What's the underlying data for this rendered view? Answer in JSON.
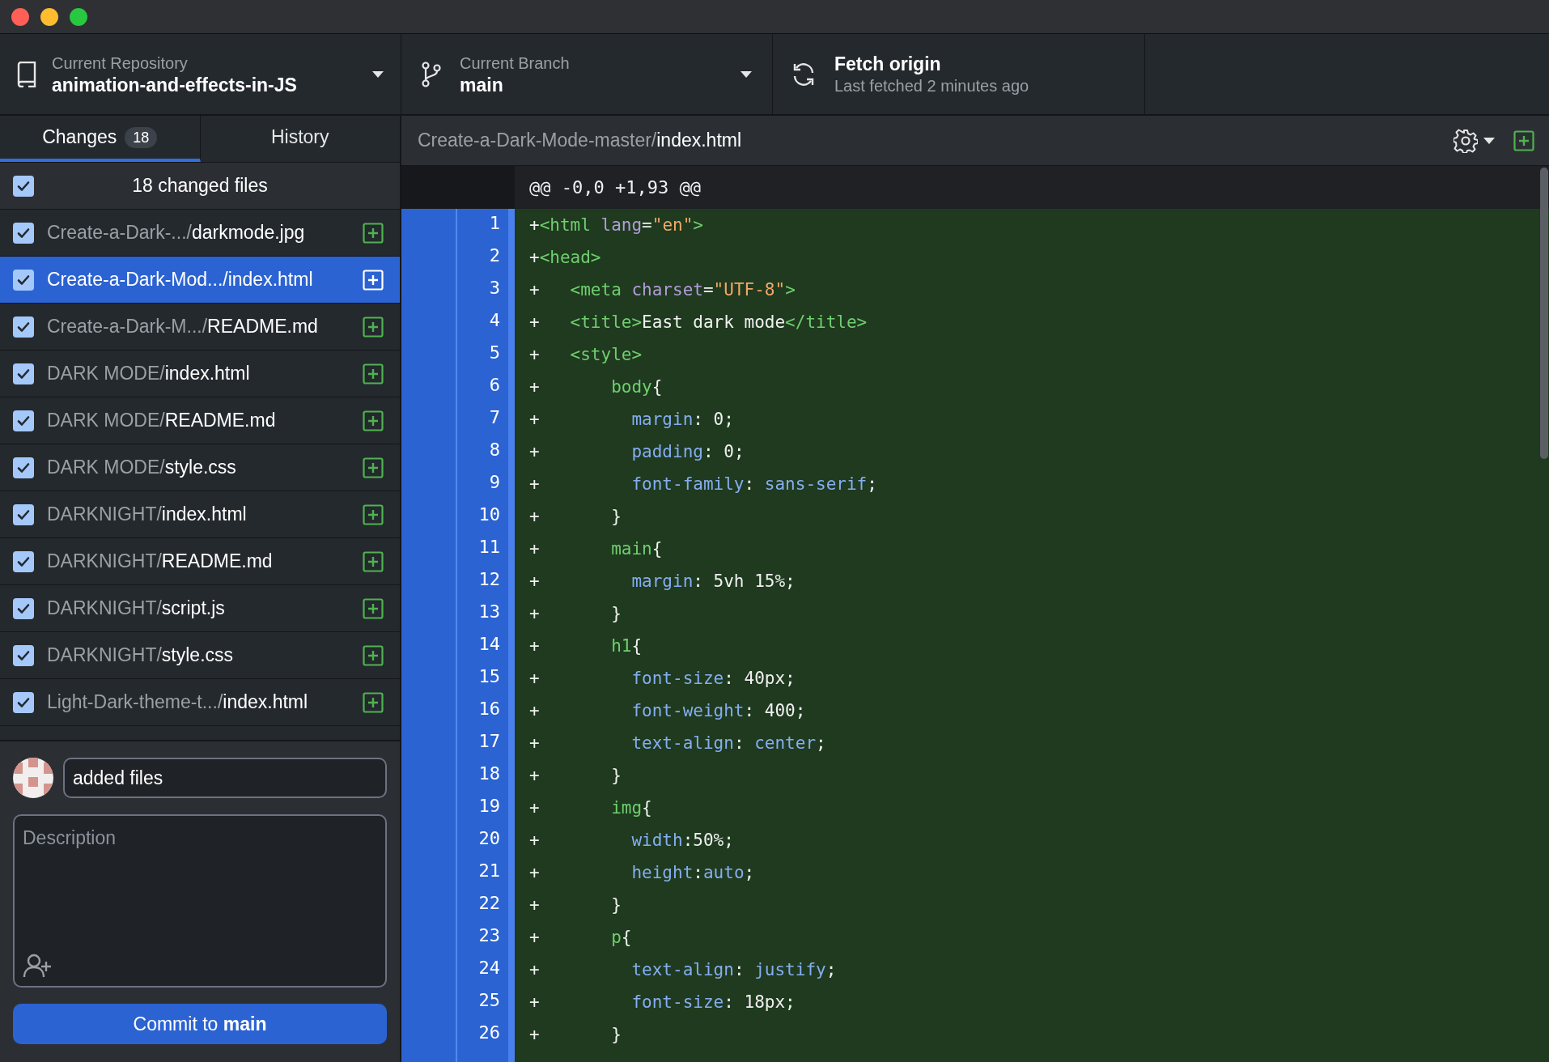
{
  "toolbar": {
    "repository": {
      "label": "Current Repository",
      "name": "animation-and-effects-in-JS"
    },
    "branch": {
      "label": "Current Branch",
      "name": "main"
    },
    "fetch": {
      "title": "Fetch origin",
      "subtitle": "Last fetched 2 minutes ago"
    }
  },
  "tabs": [
    {
      "label": "Changes",
      "count": "18",
      "selected": true
    },
    {
      "label": "History",
      "selected": false
    }
  ],
  "changes_header": {
    "label": "18 changed files",
    "checked": true
  },
  "files": [
    {
      "dir": "Create-a-Dark-.../",
      "file": "darkmode.jpg",
      "checked": true,
      "selected": false
    },
    {
      "dir": "Create-a-Dark-Mod.../",
      "file": "index.html",
      "checked": true,
      "selected": true
    },
    {
      "dir": "Create-a-Dark-M.../",
      "file": "README.md",
      "checked": true,
      "selected": false
    },
    {
      "dir": "DARK MODE/",
      "file": "index.html",
      "checked": true,
      "selected": false
    },
    {
      "dir": "DARK MODE/",
      "file": "README.md",
      "checked": true,
      "selected": false
    },
    {
      "dir": "DARK MODE/",
      "file": "style.css",
      "checked": true,
      "selected": false
    },
    {
      "dir": "DARKNIGHT/",
      "file": "index.html",
      "checked": true,
      "selected": false
    },
    {
      "dir": "DARKNIGHT/",
      "file": "README.md",
      "checked": true,
      "selected": false
    },
    {
      "dir": "DARKNIGHT/",
      "file": "script.js",
      "checked": true,
      "selected": false
    },
    {
      "dir": "DARKNIGHT/",
      "file": "style.css",
      "checked": true,
      "selected": false
    },
    {
      "dir": "Light-Dark-theme-t.../",
      "file": "index.html",
      "checked": true,
      "selected": false
    }
  ],
  "commit": {
    "summary": "added files",
    "description_placeholder": "Description",
    "button": "Commit to **main**"
  },
  "diff": {
    "path": {
      "dir": "Create-a-Dark-Mode-master/",
      "file": "index.html"
    },
    "hunk": "@@ -0,0 +1,93 @@",
    "lines": [
      {
        "number": "1",
        "tokens": [
          {
            "kind": "plain",
            "text": "+"
          },
          {
            "kind": "tag",
            "text": "<html "
          },
          {
            "kind": "attr",
            "text": "lang"
          },
          {
            "kind": "plain",
            "text": "="
          },
          {
            "kind": "string",
            "text": "\"en\""
          },
          {
            "kind": "tag",
            "text": ">"
          }
        ]
      },
      {
        "number": "2",
        "tokens": [
          {
            "kind": "plain",
            "text": "+"
          },
          {
            "kind": "tag",
            "text": "<head>"
          }
        ]
      },
      {
        "number": "3",
        "tokens": [
          {
            "kind": "plain",
            "text": "+   "
          },
          {
            "kind": "tag",
            "text": "<meta "
          },
          {
            "kind": "attr",
            "text": "charset"
          },
          {
            "kind": "plain",
            "text": "="
          },
          {
            "kind": "string",
            "text": "\"UTF-8\""
          },
          {
            "kind": "tag",
            "text": ">"
          }
        ]
      },
      {
        "number": "4",
        "tokens": [
          {
            "kind": "plain",
            "text": "+   "
          },
          {
            "kind": "tag",
            "text": "<title>"
          },
          {
            "kind": "plain",
            "text": "East dark mode"
          },
          {
            "kind": "tag",
            "text": "</title>"
          }
        ]
      },
      {
        "number": "5",
        "tokens": [
          {
            "kind": "plain",
            "text": "+   "
          },
          {
            "kind": "tag",
            "text": "<style>"
          }
        ]
      },
      {
        "number": "6",
        "tokens": [
          {
            "kind": "plain",
            "text": "+       "
          },
          {
            "kind": "selector",
            "text": "body"
          },
          {
            "kind": "plain",
            "text": "{"
          }
        ]
      },
      {
        "number": "7",
        "tokens": [
          {
            "kind": "plain",
            "text": "+         "
          },
          {
            "kind": "property",
            "text": "margin"
          },
          {
            "kind": "plain",
            "text": ": 0;"
          }
        ]
      },
      {
        "number": "8",
        "tokens": [
          {
            "kind": "plain",
            "text": "+         "
          },
          {
            "kind": "property",
            "text": "padding"
          },
          {
            "kind": "plain",
            "text": ": 0;"
          }
        ]
      },
      {
        "number": "9",
        "tokens": [
          {
            "kind": "plain",
            "text": "+         "
          },
          {
            "kind": "property",
            "text": "font-family"
          },
          {
            "kind": "plain",
            "text": ": "
          },
          {
            "kind": "value",
            "text": "sans-serif"
          },
          {
            "kind": "plain",
            "text": ";"
          }
        ]
      },
      {
        "number": "10",
        "tokens": [
          {
            "kind": "plain",
            "text": "+       }"
          }
        ]
      },
      {
        "number": "11",
        "tokens": [
          {
            "kind": "plain",
            "text": "+       "
          },
          {
            "kind": "selector",
            "text": "main"
          },
          {
            "kind": "plain",
            "text": "{"
          }
        ]
      },
      {
        "number": "12",
        "tokens": [
          {
            "kind": "plain",
            "text": "+         "
          },
          {
            "kind": "property",
            "text": "margin"
          },
          {
            "kind": "plain",
            "text": ": 5vh 15%;"
          }
        ]
      },
      {
        "number": "13",
        "tokens": [
          {
            "kind": "plain",
            "text": "+       }"
          }
        ]
      },
      {
        "number": "14",
        "tokens": [
          {
            "kind": "plain",
            "text": "+       "
          },
          {
            "kind": "selector",
            "text": "h1"
          },
          {
            "kind": "plain",
            "text": "{"
          }
        ]
      },
      {
        "number": "15",
        "tokens": [
          {
            "kind": "plain",
            "text": "+         "
          },
          {
            "kind": "property",
            "text": "font-size"
          },
          {
            "kind": "plain",
            "text": ": 40px;"
          }
        ]
      },
      {
        "number": "16",
        "tokens": [
          {
            "kind": "plain",
            "text": "+         "
          },
          {
            "kind": "property",
            "text": "font-weight"
          },
          {
            "kind": "plain",
            "text": ": 400;"
          }
        ]
      },
      {
        "number": "17",
        "tokens": [
          {
            "kind": "plain",
            "text": "+         "
          },
          {
            "kind": "property",
            "text": "text-align"
          },
          {
            "kind": "plain",
            "text": ": "
          },
          {
            "kind": "value",
            "text": "center"
          },
          {
            "kind": "plain",
            "text": ";"
          }
        ]
      },
      {
        "number": "18",
        "tokens": [
          {
            "kind": "plain",
            "text": "+       }"
          }
        ]
      },
      {
        "number": "19",
        "tokens": [
          {
            "kind": "plain",
            "text": "+       "
          },
          {
            "kind": "selector",
            "text": "img"
          },
          {
            "kind": "plain",
            "text": "{"
          }
        ]
      },
      {
        "number": "20",
        "tokens": [
          {
            "kind": "plain",
            "text": "+         "
          },
          {
            "kind": "property",
            "text": "width"
          },
          {
            "kind": "plain",
            "text": ":50%;"
          }
        ]
      },
      {
        "number": "21",
        "tokens": [
          {
            "kind": "plain",
            "text": "+         "
          },
          {
            "kind": "property",
            "text": "height"
          },
          {
            "kind": "plain",
            "text": ":"
          },
          {
            "kind": "value",
            "text": "auto"
          },
          {
            "kind": "plain",
            "text": ";"
          }
        ]
      },
      {
        "number": "22",
        "tokens": [
          {
            "kind": "plain",
            "text": "+       }"
          }
        ]
      },
      {
        "number": "23",
        "tokens": [
          {
            "kind": "plain",
            "text": "+       "
          },
          {
            "kind": "selector",
            "text": "p"
          },
          {
            "kind": "plain",
            "text": "{"
          }
        ]
      },
      {
        "number": "24",
        "tokens": [
          {
            "kind": "plain",
            "text": "+         "
          },
          {
            "kind": "property",
            "text": "text-align"
          },
          {
            "kind": "plain",
            "text": ": "
          },
          {
            "kind": "value",
            "text": "justify"
          },
          {
            "kind": "plain",
            "text": ";"
          }
        ]
      },
      {
        "number": "25",
        "tokens": [
          {
            "kind": "plain",
            "text": "+         "
          },
          {
            "kind": "property",
            "text": "font-size"
          },
          {
            "kind": "plain",
            "text": ": 18px;"
          }
        ]
      },
      {
        "number": "26",
        "tokens": [
          {
            "kind": "plain",
            "text": "+       }"
          }
        ]
      }
    ]
  }
}
